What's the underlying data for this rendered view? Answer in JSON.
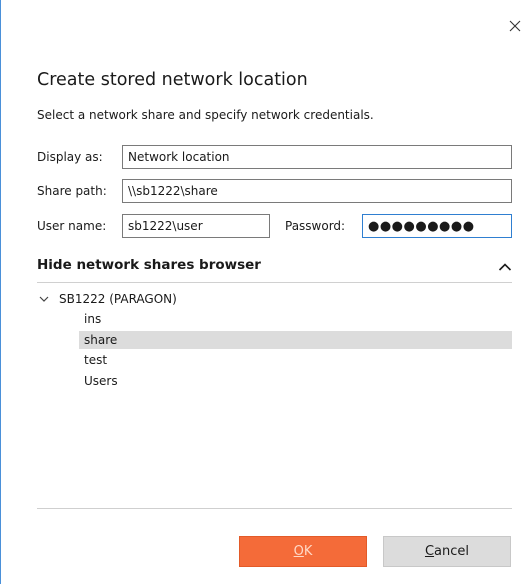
{
  "dialog": {
    "title": "Create stored network location",
    "subtitle": "Select a network share and specify network credentials."
  },
  "form": {
    "display_as_label": "Display as:",
    "display_as_value": "Network location",
    "share_path_label": "Share path:",
    "share_path_value": "\\\\sb1222\\share",
    "user_name_label": "User name:",
    "user_name_value": "sb1222\\user",
    "password_label": "Password:",
    "password_value": "●●●●●●●●●"
  },
  "browser": {
    "toggle_label": "Hide network shares browser",
    "root": "SB1222 (PARAGON)",
    "items": [
      {
        "label": "ins",
        "selected": false
      },
      {
        "label": "share",
        "selected": true
      },
      {
        "label": "test",
        "selected": false
      },
      {
        "label": "Users",
        "selected": false
      }
    ]
  },
  "buttons": {
    "ok_mnemonic": "O",
    "ok_rest": "K",
    "cancel_mnemonic": "C",
    "cancel_rest": "ancel"
  },
  "icons": {
    "close": "close-icon",
    "collapse": "chevron-up-icon",
    "tree_expand": "chevron-down-icon"
  },
  "colors": {
    "ok_button": "#f46b39",
    "selected_row": "#dcdcdc",
    "focus_border": "#2f7fd1"
  }
}
